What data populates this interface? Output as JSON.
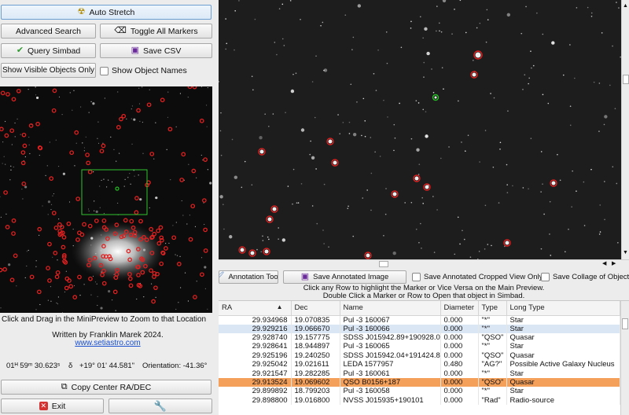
{
  "left": {
    "auto_stretch": "Auto Stretch",
    "advanced_search": "Advanced Search",
    "toggle_markers": "Toggle All Markers",
    "query_simbad": "Query Simbad",
    "save_csv": "Save CSV",
    "show_visible": "Show Visible Objects Only",
    "show_names": "Show Object Names",
    "instruction": "Click and Drag in the MiniPreview to Zoom to that Location",
    "credit": "Written by Franklin Marek 2024.",
    "website": "www.setiastro.com",
    "ra_readout": "01ᴴ 59ᵐ 30.623ˢ",
    "dec_symbol": "δ",
    "dec_readout": "+19° 01' 44.581\"",
    "orientation": "Orientation: -41.36°",
    "copy_center": "Copy Center RA/DEC",
    "exit": "Exit"
  },
  "toolbar": {
    "annotation_tools": "Annotation Tools",
    "save_annotated": "Save Annotated Image",
    "save_cropped": "Save Annotated Cropped View Only",
    "save_collage": "Save Collage of Objects",
    "hint1": "Click any Row to highlight the Marker or Vice Versa on the Main Preview.",
    "hint2": "Double Click a Marker or Row to Open that object in Simbad."
  },
  "table": {
    "headers": [
      "RA",
      "Dec",
      "Name",
      "Diameter",
      "Type",
      "Long Type"
    ],
    "rows": [
      [
        "29.934968",
        "19.070835",
        "Pul -3  160067",
        "0.000",
        "\"*\"",
        "Star"
      ],
      [
        "29.929216",
        "19.066670",
        "Pul -3  160066",
        "0.000",
        "\"*\"",
        "Star"
      ],
      [
        "29.928740",
        "19.157775",
        "SDSS J015942.89+190928.0",
        "0.000",
        "\"QSO\"",
        "Quasar"
      ],
      [
        "29.928641",
        "18.944897",
        "Pul -3  160065",
        "0.000",
        "\"*\"",
        "Star"
      ],
      [
        "29.925196",
        "19.240250",
        "SDSS J015942.04+191424.8",
        "0.000",
        "\"QSO\"",
        "Quasar"
      ],
      [
        "29.925042",
        "19.021611",
        "LEDA 1577957",
        "0.480",
        "\"AG?\"",
        "Possible Active Galaxy Nucleus"
      ],
      [
        "29.921547",
        "19.282285",
        "Pul -3  160061",
        "0.000",
        "\"*\"",
        "Star"
      ],
      [
        "29.913524",
        "19.069602",
        "QSO B0156+187",
        "0.000",
        "\"QSO\"",
        "Quasar"
      ],
      [
        "29.899892",
        "18.799203",
        "Pul -3  160058",
        "0.000",
        "\"*\"",
        "Star"
      ],
      [
        "29.898800",
        "19.016800",
        "NVSS J015935+190101",
        "0.000",
        "\"Rad\"",
        "Radio-source"
      ]
    ]
  },
  "colors": {
    "marker": "#e02020",
    "selected_marker": "#22c022",
    "highlight_row": "#f5a05a",
    "selected_row": "#dbe6f5"
  }
}
